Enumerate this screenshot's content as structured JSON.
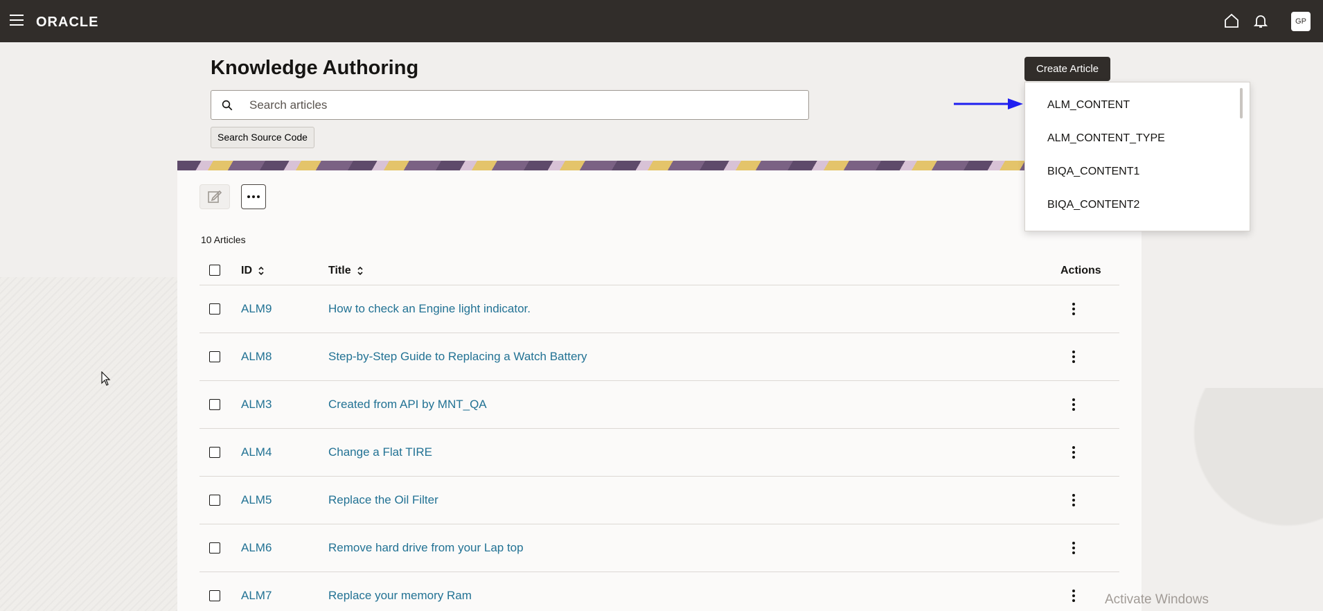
{
  "header": {
    "logo": "ORACLE",
    "avatar": "GP"
  },
  "page": {
    "title": "Knowledge Authoring",
    "search_placeholder": "Search articles",
    "search_source_label": "Search Source Code",
    "create_label": "Create Article",
    "count_label": "10 Articles"
  },
  "dropdown": {
    "items": [
      "ALM_CONTENT",
      "ALM_CONTENT_TYPE",
      "BIQA_CONTENT1",
      "BIQA_CONTENT2"
    ]
  },
  "table": {
    "columns": {
      "id": "ID",
      "title": "Title",
      "actions": "Actions"
    },
    "rows": [
      {
        "id": "ALM9",
        "title": "How to check an Engine light indicator."
      },
      {
        "id": "ALM8",
        "title": "Step-by-Step Guide to Replacing a Watch Battery"
      },
      {
        "id": "ALM3",
        "title": "Created from API by MNT_QA"
      },
      {
        "id": "ALM4",
        "title": "Change a Flat TIRE"
      },
      {
        "id": "ALM5",
        "title": "Replace the Oil Filter"
      },
      {
        "id": "ALM6",
        "title": "Remove hard drive from your Lap top"
      },
      {
        "id": "ALM7",
        "title": "Replace your memory Ram"
      }
    ]
  },
  "overlay": {
    "activate_windows": "Activate Windows"
  },
  "colors": {
    "header_bg": "#312d2a",
    "link": "#227294",
    "arrow": "#1f1ff0"
  }
}
